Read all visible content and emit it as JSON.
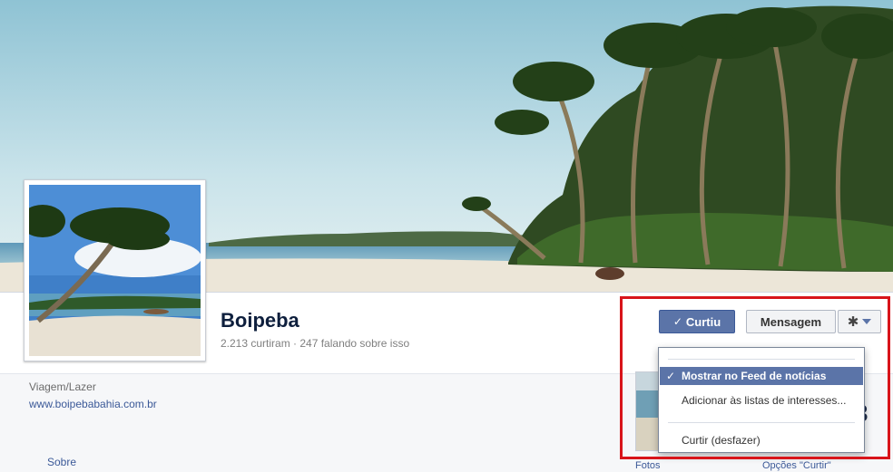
{
  "page": {
    "name": "Boipeba",
    "stats": "2.213 curtiram · 247 falando sobre isso",
    "category": "Viagem/Lazer",
    "website": "www.boipebabahia.com.br"
  },
  "nav": {
    "about": "Sobre",
    "photos": "Fotos",
    "likes_options": "Opções \"Curtir\""
  },
  "actions": {
    "liked_check": "✓",
    "liked": "Curtiu",
    "message": "Mensagem",
    "gear": "✱"
  },
  "dropdown": {
    "items": [
      {
        "check": "✓",
        "label": "Mostrar no Feed de notícias"
      },
      {
        "check": "",
        "label": "Adicionar às listas de interesses..."
      },
      {
        "check": "",
        "label": "Curtir (desfazer)"
      }
    ]
  },
  "partial_count": "3",
  "colors": {
    "brand_blue": "#3b5998",
    "liked_button": "#5b74a8",
    "highlight_red": "#d8141a"
  }
}
